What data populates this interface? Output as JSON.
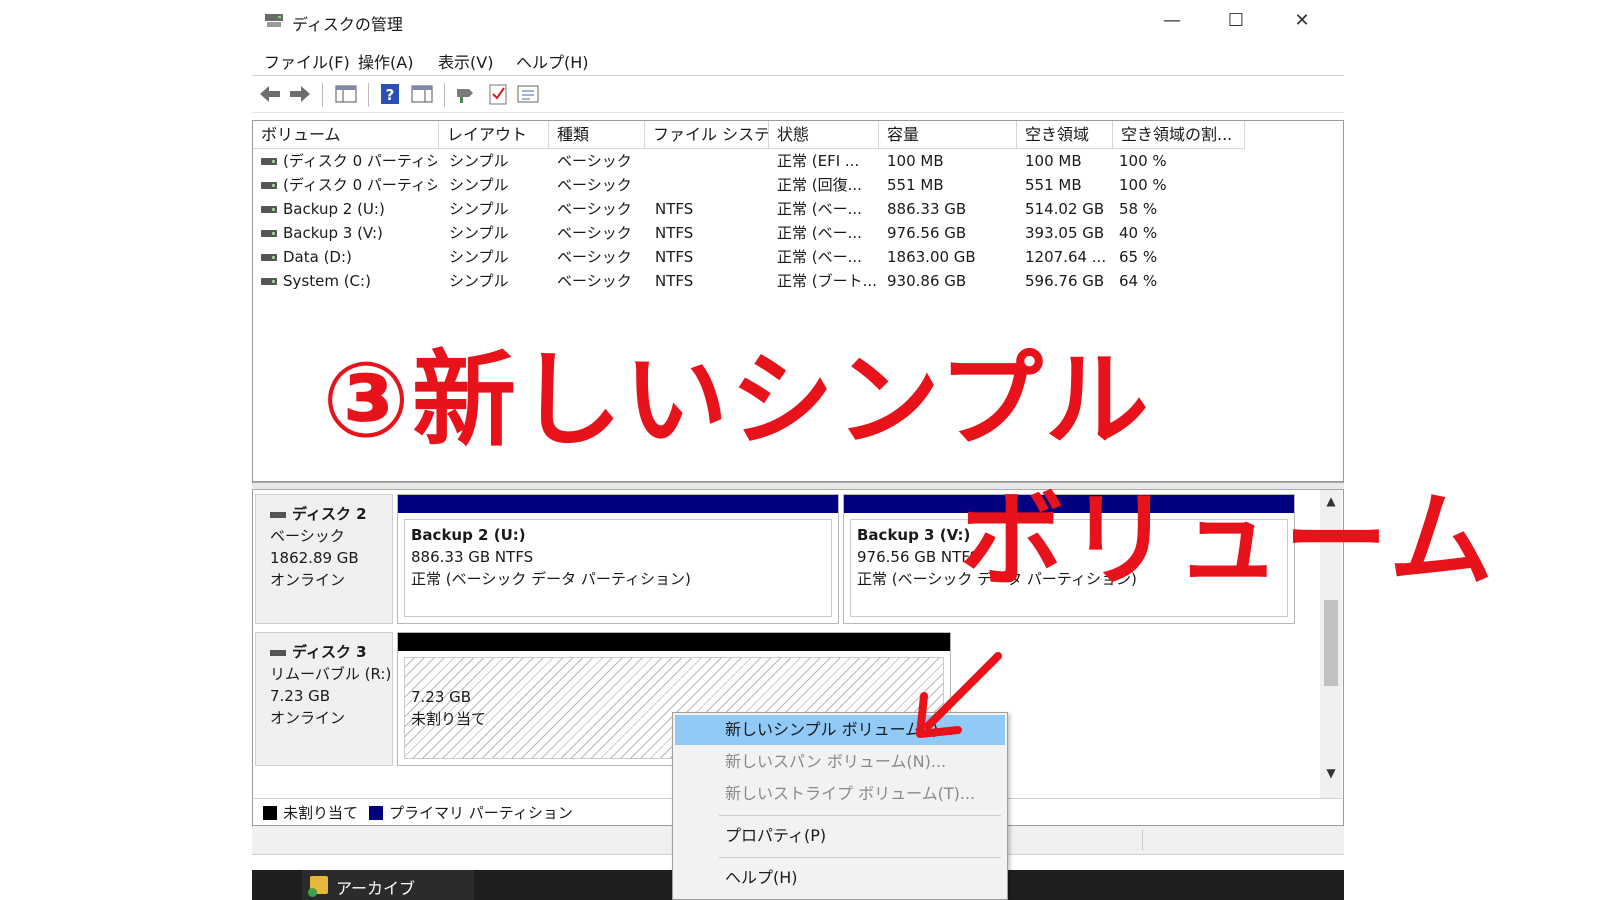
{
  "window": {
    "title": "ディスクの管理",
    "controls": {
      "minimize": "—",
      "maximize": "☐",
      "close": "✕"
    }
  },
  "menu": {
    "items": [
      "ファイル(F)",
      "操作(A)",
      "表示(V)",
      "ヘルプ(H)"
    ]
  },
  "toolbar": {
    "icons": [
      "back-arrow-icon",
      "forward-arrow-icon",
      "console-tree-icon",
      "help-icon",
      "properties-icon",
      "connect-icon",
      "check-icon",
      "list-icon"
    ]
  },
  "volume_table": {
    "columns": [
      "ボリューム",
      "レイアウト",
      "種類",
      "ファイル システム",
      "状態",
      "容量",
      "空き領域",
      "空き領域の割..."
    ],
    "rows": [
      {
        "volume": "(ディスク 0 パーティシ...",
        "layout": "シンプル",
        "type": "ベーシック",
        "fs": "",
        "status": "正常 (EFI ...",
        "capacity": "100 MB",
        "free": "100 MB",
        "pct": "100 %"
      },
      {
        "volume": "(ディスク 0 パーティシ...",
        "layout": "シンプル",
        "type": "ベーシック",
        "fs": "",
        "status": "正常 (回復...",
        "capacity": "551 MB",
        "free": "551 MB",
        "pct": "100 %"
      },
      {
        "volume": "Backup 2 (U:)",
        "layout": "シンプル",
        "type": "ベーシック",
        "fs": "NTFS",
        "status": "正常 (ベー...",
        "capacity": "886.33 GB",
        "free": "514.02 GB",
        "pct": "58 %"
      },
      {
        "volume": "Backup 3 (V:)",
        "layout": "シンプル",
        "type": "ベーシック",
        "fs": "NTFS",
        "status": "正常 (ベー...",
        "capacity": "976.56 GB",
        "free": "393.05 GB",
        "pct": "40 %"
      },
      {
        "volume": "Data (D:)",
        "layout": "シンプル",
        "type": "ベーシック",
        "fs": "NTFS",
        "status": "正常 (ベー...",
        "capacity": "1863.00 GB",
        "free": "1207.64 ...",
        "pct": "65 %"
      },
      {
        "volume": "System (C:)",
        "layout": "シンプル",
        "type": "ベーシック",
        "fs": "NTFS",
        "status": "正常 (ブート...",
        "capacity": "930.86 GB",
        "free": "596.76 GB",
        "pct": "64 %"
      }
    ]
  },
  "disks": {
    "disk2": {
      "name": "ディスク 2",
      "type": "ベーシック",
      "size": "1862.89 GB",
      "state": "オンライン",
      "partitions": [
        {
          "name": "Backup 2  (U:)",
          "size_fs": "886.33 GB NTFS",
          "status": "正常 (ベーシック データ パーティション)"
        },
        {
          "name": "Backup 3  (V:)",
          "size_fs": "976.56 GB NTFS",
          "status": "正常 (ベーシック データ パーティション)"
        }
      ]
    },
    "disk3": {
      "name": "ディスク 3",
      "type": "リムーバブル (R:)",
      "size": "7.23 GB",
      "state": "オンライン",
      "partitions": [
        {
          "size": "7.23 GB",
          "label": "未割り当て"
        }
      ]
    }
  },
  "legend": {
    "unallocated": "未割り当て",
    "primary": "プライマリ パーティション"
  },
  "taskbar": {
    "item": "アーカイブ"
  },
  "context_menu": {
    "items": [
      {
        "label": "新しいシンプル ボリューム(I)...",
        "state": "highlighted"
      },
      {
        "label": "新しいスパン ボリューム(N)...",
        "state": "disabled"
      },
      {
        "label": "新しいストライプ ボリューム(T)...",
        "state": "disabled"
      },
      {
        "label": "プロパティ(P)",
        "state": "enabled"
      },
      {
        "label": "ヘルプ(H)",
        "state": "enabled"
      }
    ]
  },
  "annotation": {
    "line1": "③新しいシンプル",
    "line2": "ボリューム",
    "arrow": "↙"
  },
  "colors": {
    "primary_partition": "#000080",
    "unallocated": "#000000",
    "annotation": "#e8121b",
    "menu_highlight": "#91c9f7"
  }
}
